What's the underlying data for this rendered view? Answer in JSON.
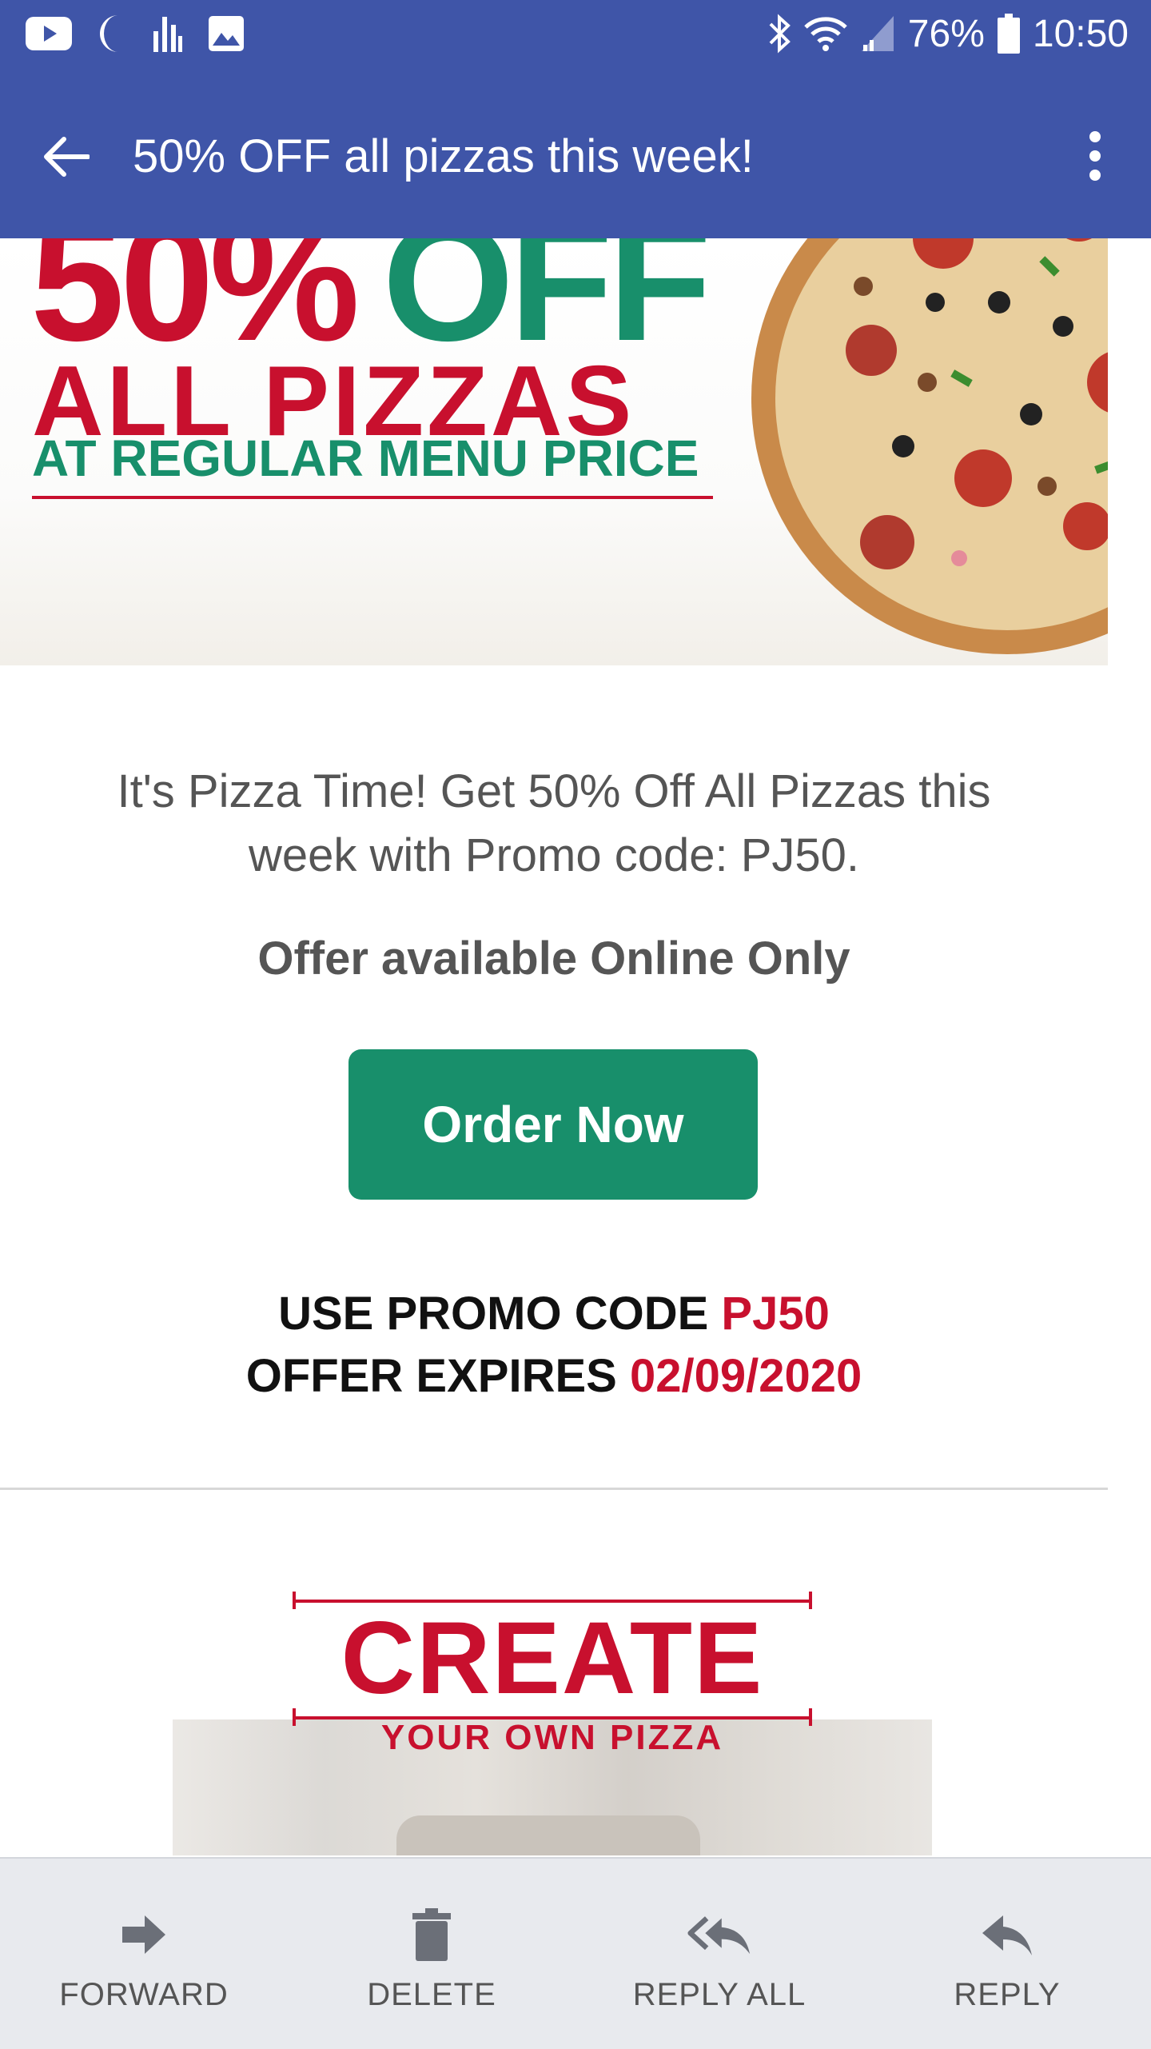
{
  "status_bar": {
    "battery": "76%",
    "time": "10:50",
    "icons": [
      "youtube-icon",
      "moon-icon",
      "signal-bars-icon",
      "image-icon",
      "bluetooth-icon",
      "wifi-icon",
      "cell-signal-icon",
      "battery-icon"
    ]
  },
  "app_bar": {
    "title": "50% OFF all pizzas this week!",
    "back_icon": "arrow-back-icon",
    "menu_icon": "more-vert-icon"
  },
  "banner": {
    "pct": "50%",
    "off": "OFF",
    "line2": "ALL PIZZAS",
    "line3": "AT REGULAR MENU PRICE"
  },
  "email": {
    "intro": "It's Pizza Time! Get 50% Off All Pizzas this week with Promo code: PJ50.",
    "online_only": "Offer available Online Only",
    "order_button": "Order Now",
    "promo_label": "USE PROMO CODE",
    "promo_code": "PJ50",
    "expires_label": "OFFER EXPIRES",
    "expires_date": "02/09/2020"
  },
  "create_banner": {
    "title": "CREATE",
    "subtitle": "YOUR OWN PIZZA"
  },
  "toolbar": {
    "items": [
      {
        "label": "FORWARD",
        "icon": "forward-icon"
      },
      {
        "label": "DELETE",
        "icon": "trash-icon"
      },
      {
        "label": "REPLY ALL",
        "icon": "reply-all-icon"
      },
      {
        "label": "REPLY",
        "icon": "reply-icon"
      }
    ]
  },
  "colors": {
    "primary": "#3f55a8",
    "brand_red": "#c8102e",
    "brand_green": "#188f6b"
  }
}
